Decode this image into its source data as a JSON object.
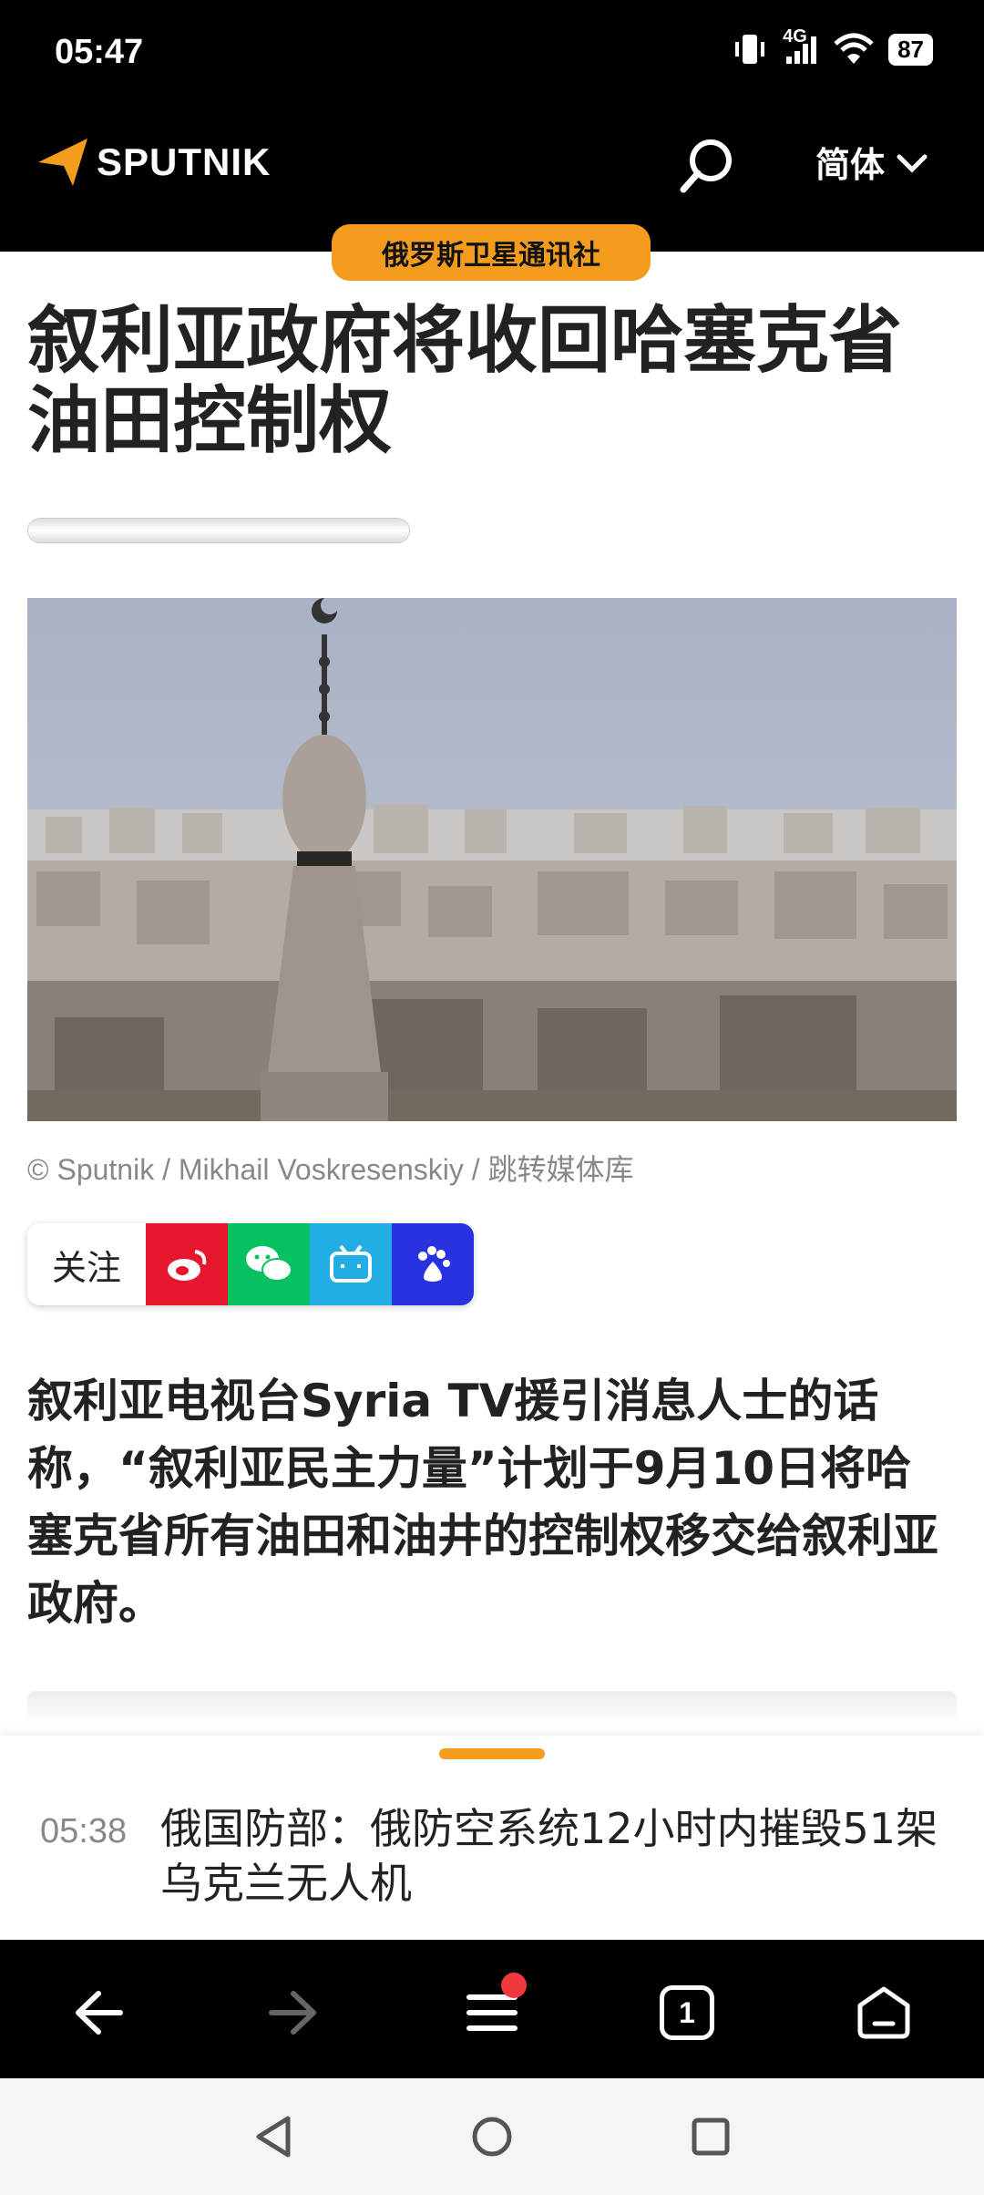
{
  "status_bar": {
    "time": "05:47",
    "battery": "87",
    "network": "4G"
  },
  "header": {
    "brand": "SPUTNIK",
    "language_label": "简体",
    "agency": "俄罗斯卫星通讯社"
  },
  "article": {
    "headline": "叙利亚政府将收回哈塞克省油田控制权",
    "image_caption": "© Sputnik / Mikhail Voskresenskiy / 跳转媒体库",
    "follow_label": "关注",
    "share_buttons": [
      "weibo-icon",
      "wechat-icon",
      "bilibili-icon",
      "baidu-icon"
    ],
    "lead": "叙利亚电视台Syria TV援引消息人士的话称，“叙利亚民主力量”计划于9月10日将哈塞克省所有油田和油井的控制权移交给叙利亚政府。"
  },
  "ticker": {
    "time": "05:38",
    "text": "俄国防部：俄防空系统12小时内摧毁51架乌克兰无人机"
  },
  "browser_nav": {
    "tabs_count": "1"
  },
  "colors": {
    "brand_orange": "#f39c1e",
    "weibo": "#e6162d",
    "wechat": "#07c160",
    "bilibili": "#23ade5",
    "baidu": "#2932e1"
  }
}
